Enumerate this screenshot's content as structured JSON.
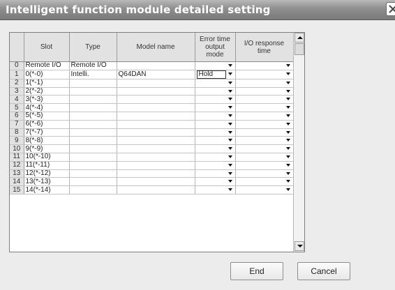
{
  "window": {
    "title": "Intelligent function module detailed setting"
  },
  "grid": {
    "columns": {
      "slot": "Slot",
      "type": "Type",
      "model": "Model name",
      "error_mode": "Error time\noutput\nmode",
      "io_response": "I/O response\ntime"
    },
    "rows": [
      {
        "num": "0",
        "slot": "Remote I/O",
        "type": "Remote I/O",
        "model": "",
        "error_mode": "",
        "io_response": ""
      },
      {
        "num": "1",
        "slot": "0(*-0)",
        "type": "Intelli.",
        "model": "Q64DAN",
        "error_mode": "Hold",
        "io_response": ""
      },
      {
        "num": "2",
        "slot": "1(*-1)",
        "type": "",
        "model": "",
        "error_mode": "",
        "io_response": ""
      },
      {
        "num": "3",
        "slot": "2(*-2)",
        "type": "",
        "model": "",
        "error_mode": "",
        "io_response": ""
      },
      {
        "num": "4",
        "slot": "3(*-3)",
        "type": "",
        "model": "",
        "error_mode": "",
        "io_response": ""
      },
      {
        "num": "5",
        "slot": "4(*-4)",
        "type": "",
        "model": "",
        "error_mode": "",
        "io_response": ""
      },
      {
        "num": "6",
        "slot": "5(*-5)",
        "type": "",
        "model": "",
        "error_mode": "",
        "io_response": ""
      },
      {
        "num": "7",
        "slot": "6(*-6)",
        "type": "",
        "model": "",
        "error_mode": "",
        "io_response": ""
      },
      {
        "num": "8",
        "slot": "7(*-7)",
        "type": "",
        "model": "",
        "error_mode": "",
        "io_response": ""
      },
      {
        "num": "9",
        "slot": "8(*-8)",
        "type": "",
        "model": "",
        "error_mode": "",
        "io_response": ""
      },
      {
        "num": "10",
        "slot": "9(*-9)",
        "type": "",
        "model": "",
        "error_mode": "",
        "io_response": ""
      },
      {
        "num": "11",
        "slot": "10(*-10)",
        "type": "",
        "model": "",
        "error_mode": "",
        "io_response": ""
      },
      {
        "num": "12",
        "slot": "11(*-11)",
        "type": "",
        "model": "",
        "error_mode": "",
        "io_response": ""
      },
      {
        "num": "13",
        "slot": "12(*-12)",
        "type": "",
        "model": "",
        "error_mode": "",
        "io_response": ""
      },
      {
        "num": "14",
        "slot": "13(*-13)",
        "type": "",
        "model": "",
        "error_mode": "",
        "io_response": ""
      },
      {
        "num": "15",
        "slot": "14(*-14)",
        "type": "",
        "model": "",
        "error_mode": "",
        "io_response": ""
      }
    ]
  },
  "buttons": {
    "end": "End",
    "cancel": "Cancel"
  }
}
